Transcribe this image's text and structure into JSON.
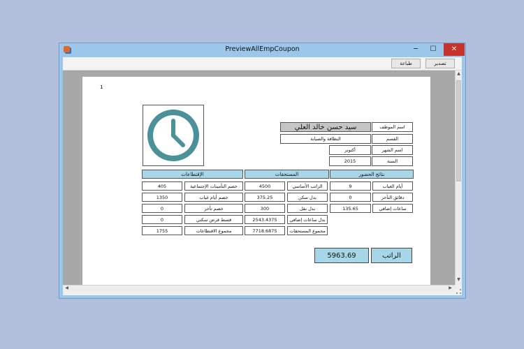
{
  "window": {
    "title": "PreviewAllEmpCoupon",
    "min_glyph": "─",
    "max_glyph": "☐",
    "close_glyph": "✕",
    "icon": "app-icon"
  },
  "toolbar": {
    "print_label": "طباعة",
    "export_label": "تصدير"
  },
  "report": {
    "page_number": "1",
    "photo_icon": "clock-icon",
    "employee": {
      "name_label": "اسم الموظف",
      "name_value": "سيد حسن خالد العلي",
      "dept_label": "القسم",
      "dept_value": "النظافة والصيانة",
      "month_label": "اسم الشهر",
      "month_value": "أكتوبر",
      "year_label": "السنة",
      "year_value": "2015"
    },
    "attendance": {
      "header": "نتائج الحضور",
      "rows": [
        {
          "label": "أيام الغياب",
          "value": "9"
        },
        {
          "label": "دقائق التأخر",
          "value": "0"
        },
        {
          "label": "ساعات إضافي",
          "value": "135.65"
        }
      ]
    },
    "earnings": {
      "header": "المستحقات",
      "rows": [
        {
          "label": "الراتب الأساسي",
          "value": "4500"
        },
        {
          "label": "بدل سكن",
          "value": "375.25"
        },
        {
          "label": "بدل نقل",
          "value": "300"
        },
        {
          "label": "بدل ساعات إضافي",
          "value": "2543.4375"
        },
        {
          "label": "مجموع المستحقات",
          "value": "7718.6875"
        }
      ]
    },
    "deductions": {
      "header": "الإقتطاعات",
      "rows": [
        {
          "label": "خصم التأمينات الإجتماعية",
          "value": "405"
        },
        {
          "label": "خصم أيام غياب",
          "value": "1350"
        },
        {
          "label": "خصم تأخر",
          "value": "0"
        },
        {
          "label": "قسط قرض سكني",
          "value": "0"
        },
        {
          "label": "مجموع الاقتطاعات",
          "value": "1755"
        }
      ]
    },
    "salary": {
      "label": "الراتب",
      "value": "5963.69"
    }
  },
  "colors": {
    "header_fill": "#a6d6e8",
    "clock": "#4a9199",
    "close_button": "#c7322b"
  }
}
